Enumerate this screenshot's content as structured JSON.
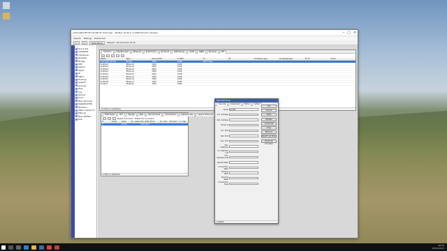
{
  "window": {
    "title": "admin@E4:8D:8C:DA:6B:32 (Tutorials) - WinBox v6.35.2 on RB2011UAS (mipsbe)",
    "menu": [
      "Session",
      "Settings",
      "Dashboard"
    ],
    "safe_mode": "Safe Mode",
    "session": "Session: 10.10.10.10 10.11"
  },
  "sidebar": {
    "items": [
      "Quick Set",
      "CAPsMAN",
      "Interfaces",
      "Wireless",
      "Bridge",
      "PPP",
      "Switch",
      "Mesh",
      "IP",
      "MPLS",
      "Routing",
      "System",
      "Queues",
      "Files",
      "Log",
      "Radius",
      "Tools",
      "New Terminal",
      "MetaROUTER",
      "Partition",
      "Make Supout.rif",
      "Manual",
      "New WinBox",
      "Exit"
    ]
  },
  "interface_list": {
    "tabs": [
      "Interface",
      "Interface List",
      "Ethernet",
      "EoIP Tunnel",
      "IP Tunnel",
      "GRE Tunnel",
      "VLAN",
      "VRRP",
      "Bonding",
      "LTE"
    ],
    "columns": [
      "Name",
      "Type",
      "Actual MTU",
      "L2 MTU",
      "Tx",
      "Rx",
      "Tx Packet (p/s)",
      "Rx Packet (p/s)",
      "FP Tx",
      "FP Rx"
    ],
    "rows": [
      [
        "R  bridge1_WLAN",
        "Bridge",
        "1500",
        "1598",
        "168.3 kbps",
        "",
        "",
        "",
        "",
        ""
      ],
      [
        "R  ether1",
        "Ethernet",
        "1500",
        "1598",
        "",
        "",
        "",
        "",
        "",
        ""
      ],
      [
        "R  ether2",
        "Ethernet",
        "1500",
        "1598",
        "",
        "",
        "",
        "",
        "",
        ""
      ],
      [
        "R  ether3",
        "Ethernet",
        "1500",
        "1598",
        "",
        "",
        "",
        "",
        "",
        ""
      ],
      [
        "R  ether4",
        "Ethernet",
        "1500",
        "1598",
        "",
        "",
        "",
        "",
        "",
        ""
      ],
      [
        "R  ether5",
        "Ethernet",
        "1500",
        "1598",
        "",
        "",
        "",
        "",
        "",
        ""
      ],
      [
        "R  ether6",
        "Ethernet",
        "1500",
        "1598",
        "",
        "",
        "",
        "",
        "",
        ""
      ],
      [
        "R  ether7",
        "Ethernet",
        "1500",
        "1598",
        "",
        "",
        "",
        "",
        "",
        ""
      ],
      [
        "R  ether8",
        "Ethernet",
        "1500",
        "1598",
        "",
        "",
        "",
        "",
        "",
        ""
      ],
      [
        "R  wlan1",
        "Wireless",
        "1500",
        "1600",
        "",
        "",
        "",
        "",
        "",
        ""
      ]
    ],
    "status": "12 items (1 selected)"
  },
  "firewall": {
    "tabs": [
      "Filter Rules",
      "NAT",
      "Mangle",
      "Raw",
      "Service Ports",
      "Connections",
      "Address Lists",
      "Layer7 Protocols"
    ],
    "reset": [
      "Reset Counters",
      "Reset All Counters"
    ],
    "columns": [
      "#",
      "Action",
      "Chain",
      "Src. Address",
      "Dst. Address",
      "Proto",
      "Src. Port",
      "Dst. Port",
      "In. Inter"
    ],
    "rows": [
      [
        "0",
        "",
        "srcnat",
        "",
        "192.168.1...",
        "",
        "",
        "",
        ""
      ]
    ],
    "status": "1 item (1 selected)"
  },
  "nat_rule": {
    "title": "New NAT Rule",
    "tabs": [
      "General",
      "Advanced",
      "Extra",
      "Action"
    ],
    "fields": [
      "Chain",
      "Src. Address",
      "Dst. Address",
      "Protocol",
      "Src. Port",
      "Dst. Port",
      "Any. Port",
      "Out. Interface",
      "In. Interface List",
      "Out. Interface List",
      "Packet Mark",
      "Connection Mark",
      "Routing Mark",
      "Routing Table",
      "Connection Type"
    ],
    "chain_value": "srcnat",
    "buttons": [
      "OK",
      "Cancel",
      "Apply",
      "Disable",
      "Comment",
      "Copy",
      "Remove",
      "Reset Counters",
      "Reset All Counters"
    ],
    "status": "enabled"
  },
  "taskbar": {
    "time": "20:00",
    "date": "24/11/2017"
  }
}
